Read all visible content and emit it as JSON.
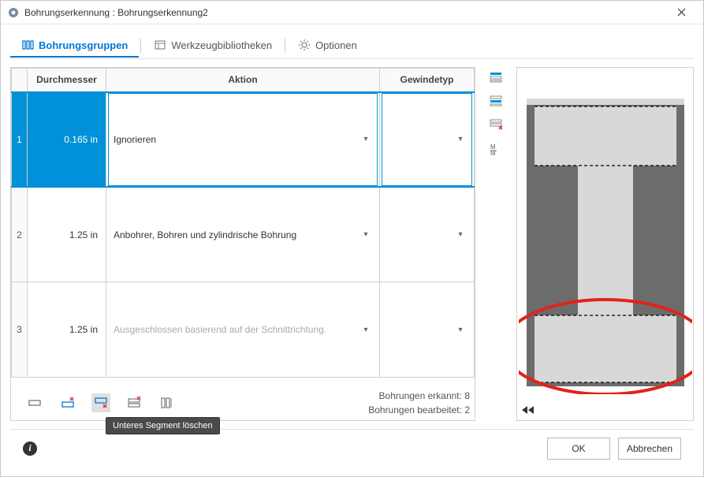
{
  "window": {
    "title": "Bohrungserkennung : Bohrungserkennung2"
  },
  "tabs": {
    "groups": "Bohrungsgruppen",
    "toollibs": "Werkzeugbibliotheken",
    "options": "Optionen"
  },
  "grid": {
    "headers": {
      "diameter": "Durchmesser",
      "action": "Aktion",
      "threadtype": "Gewindetyp"
    },
    "rows": [
      {
        "idx": "1",
        "diameter": "0.165 in",
        "action": "Ignorieren",
        "thread": "",
        "selected": true,
        "muted": false
      },
      {
        "idx": "2",
        "diameter": "1.25 in",
        "action": "Anbohrer, Bohren und zylindrische Bohrung",
        "thread": "",
        "selected": false,
        "muted": false
      },
      {
        "idx": "3",
        "diameter": "1.25 in",
        "action": "Ausgeschlossen basierend auf der Schnittrichtung.",
        "thread": "",
        "selected": false,
        "muted": true
      }
    ]
  },
  "status": {
    "detected_label": "Bohrungen erkannt:",
    "detected_count": "8",
    "processed_label": "Bohrungen bearbeitet:",
    "processed_count": "2"
  },
  "tooltip": "Unteres Segment löschen",
  "buttons": {
    "ok": "OK",
    "cancel": "Abbrechen"
  }
}
